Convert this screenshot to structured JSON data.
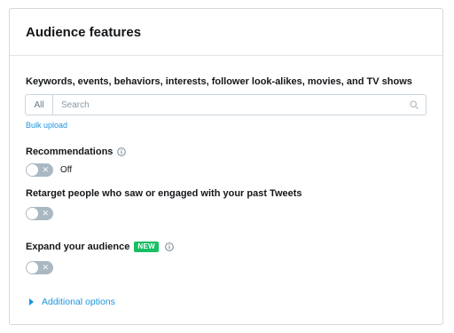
{
  "card": {
    "title": "Audience features"
  },
  "targeting": {
    "label": "Keywords, events, behaviors, interests, follower look-alikes, movies, and TV shows",
    "scope_value": "All",
    "search_placeholder": "Search",
    "search_value": "",
    "bulk_upload_label": "Bulk upload"
  },
  "recommendations": {
    "label": "Recommendations",
    "toggle_on": false,
    "state_label": "Off"
  },
  "retarget": {
    "label": "Retarget people who saw or engaged with your past Tweets",
    "toggle_on": false
  },
  "expand": {
    "label": "Expand your audience",
    "badge": "NEW",
    "toggle_on": false
  },
  "additional_options": {
    "label": "Additional options"
  },
  "icons": {
    "search": "search-icon",
    "info": "info-icon",
    "caret": "caret-right-icon"
  },
  "colors": {
    "accent": "#1b95e0",
    "toggle_off": "#aab8c2",
    "badge": "#17bf63",
    "text": "#14171a"
  }
}
